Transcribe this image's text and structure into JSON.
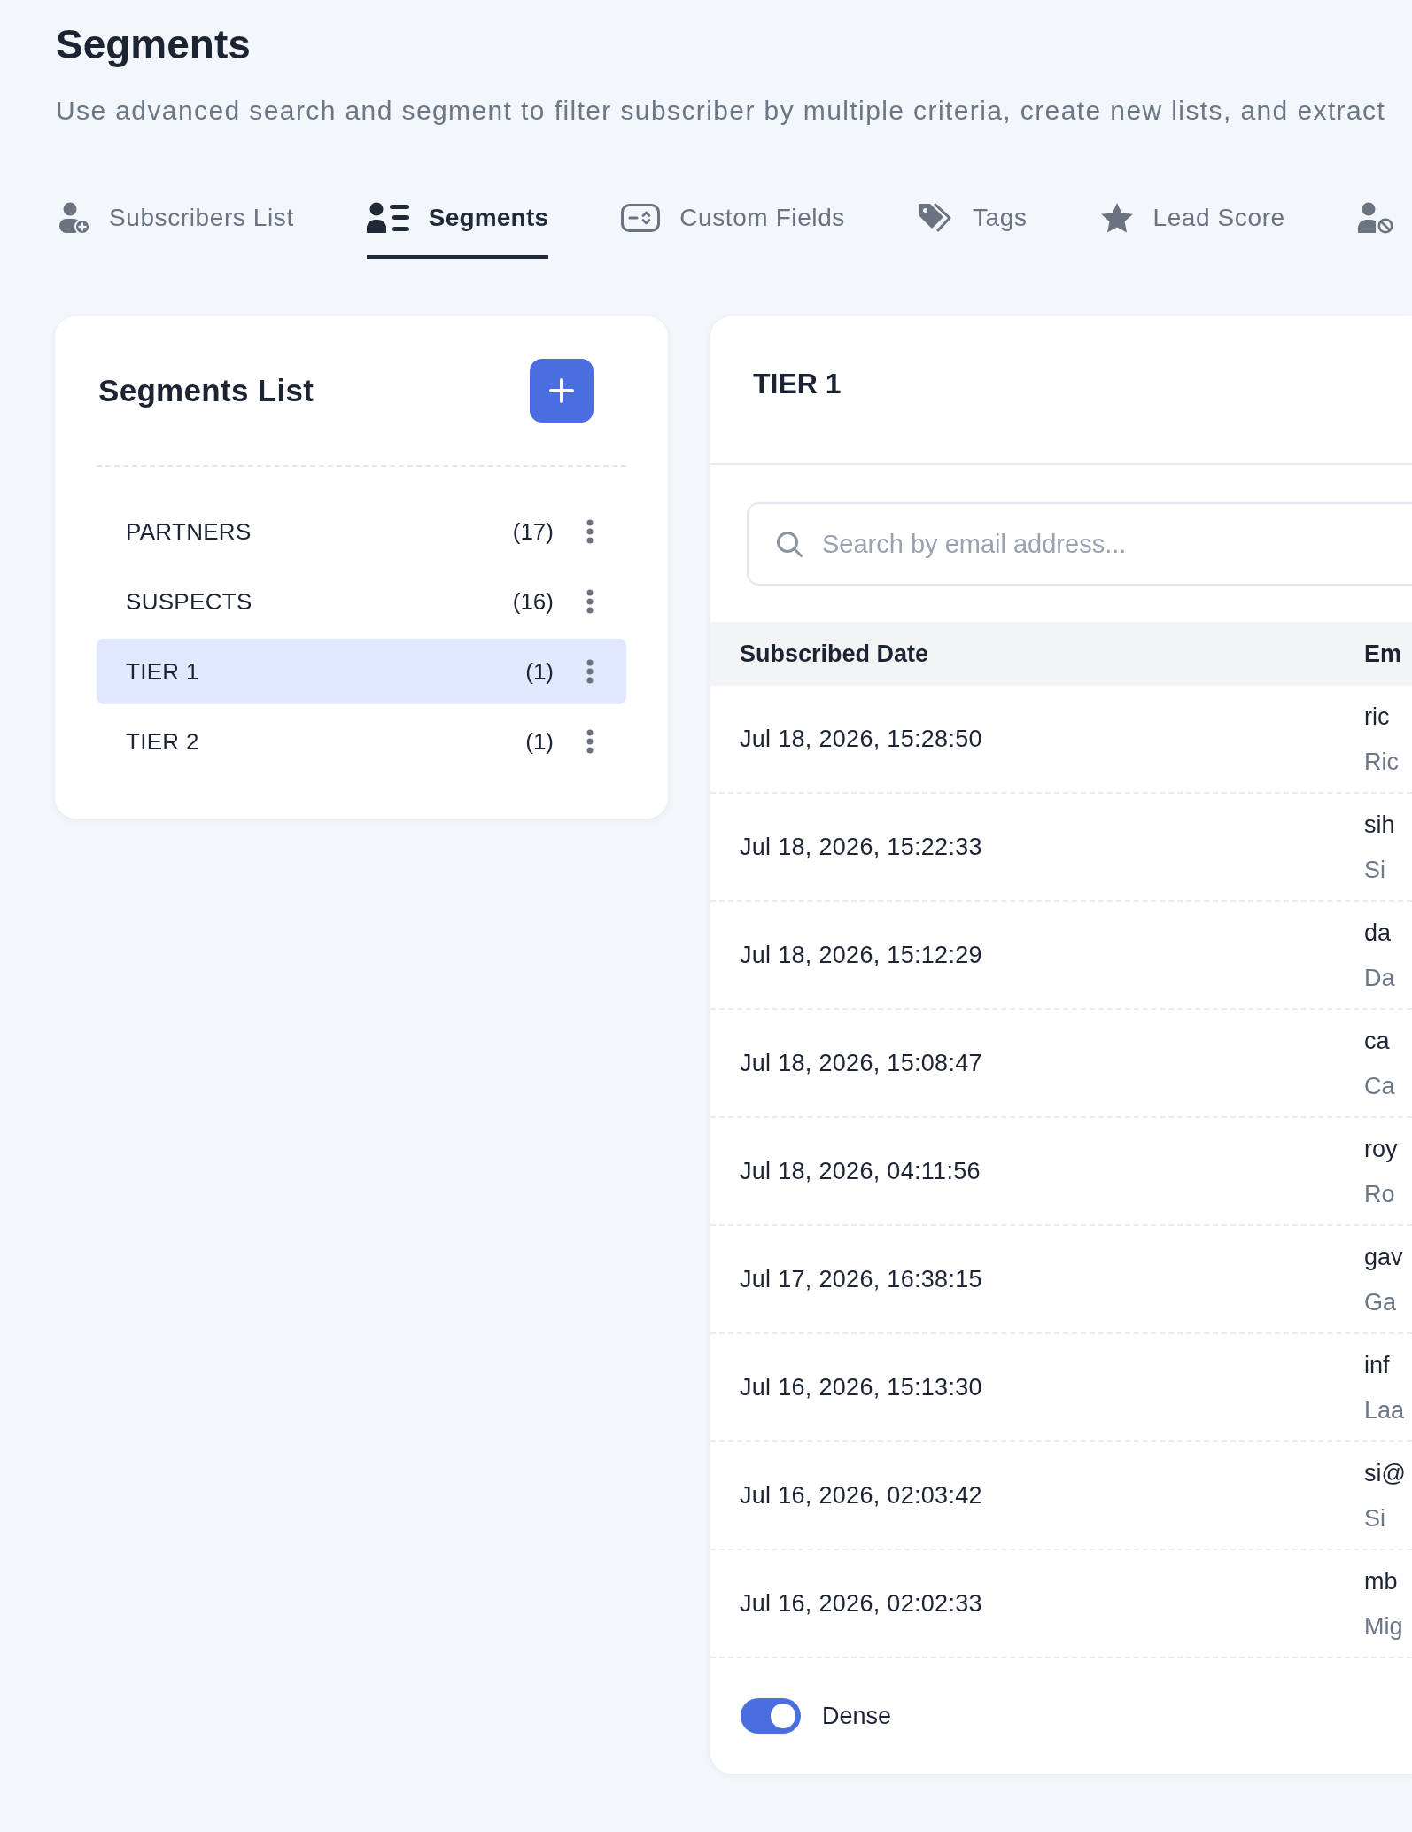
{
  "header": {
    "title": "Segments",
    "subtitle": "Use advanced search and segment to filter subscriber by multiple criteria, create new lists, and extract"
  },
  "tabs": [
    {
      "label": "Subscribers List",
      "selected": false
    },
    {
      "label": "Segments",
      "selected": true
    },
    {
      "label": "Custom Fields",
      "selected": false
    },
    {
      "label": "Tags",
      "selected": false
    },
    {
      "label": "Lead Score",
      "selected": false
    },
    {
      "selected": false
    }
  ],
  "segments_list": {
    "title": "Segments List",
    "items": [
      {
        "name": "PARTNERS",
        "count": "(17)",
        "selected": false
      },
      {
        "name": "SUSPECTS",
        "count": "(16)",
        "selected": false
      },
      {
        "name": "TIER 1",
        "count": "(1)",
        "selected": true
      },
      {
        "name": "TIER 2",
        "count": "(1)",
        "selected": false
      }
    ]
  },
  "segment_detail": {
    "title": "TIER 1",
    "search": {
      "placeholder": "Search by email address..."
    },
    "table": {
      "columns": [
        "Subscribed Date",
        "Em"
      ],
      "rows": [
        {
          "subscribed_date": "Jul 18, 2026, 15:28:50",
          "column_2": {
            "line_1": "ric",
            "line_2": "Ric"
          }
        },
        {
          "subscribed_date": "Jul 18, 2026, 15:22:33",
          "column_2": {
            "line_1": "sih",
            "line_2": "Si"
          }
        },
        {
          "subscribed_date": "Jul 18, 2026, 15:12:29",
          "column_2": {
            "line_1": "da",
            "line_2": "Da"
          }
        },
        {
          "subscribed_date": "Jul 18, 2026, 15:08:47",
          "column_2": {
            "line_1": "ca",
            "line_2": "Ca"
          }
        },
        {
          "subscribed_date": "Jul 18, 2026, 04:11:56",
          "column_2": {
            "line_1": "roy",
            "line_2": "Ro"
          }
        },
        {
          "subscribed_date": "Jul 17, 2026, 16:38:15",
          "column_2": {
            "line_1": "gav",
            "line_2": "Ga"
          }
        },
        {
          "subscribed_date": "Jul 16, 2026, 15:13:30",
          "column_2": {
            "line_1": "inf",
            "line_2": "Laa"
          }
        },
        {
          "subscribed_date": "Jul 16, 2026, 02:03:42",
          "column_2": {
            "line_1": "si@",
            "line_2": "Si"
          }
        },
        {
          "subscribed_date": "Jul 16, 2026, 02:02:33",
          "column_2": {
            "line_1": "mb",
            "line_2": "Mig"
          }
        }
      ]
    },
    "dense_toggle": {
      "label": "Dense",
      "on": true
    }
  }
}
